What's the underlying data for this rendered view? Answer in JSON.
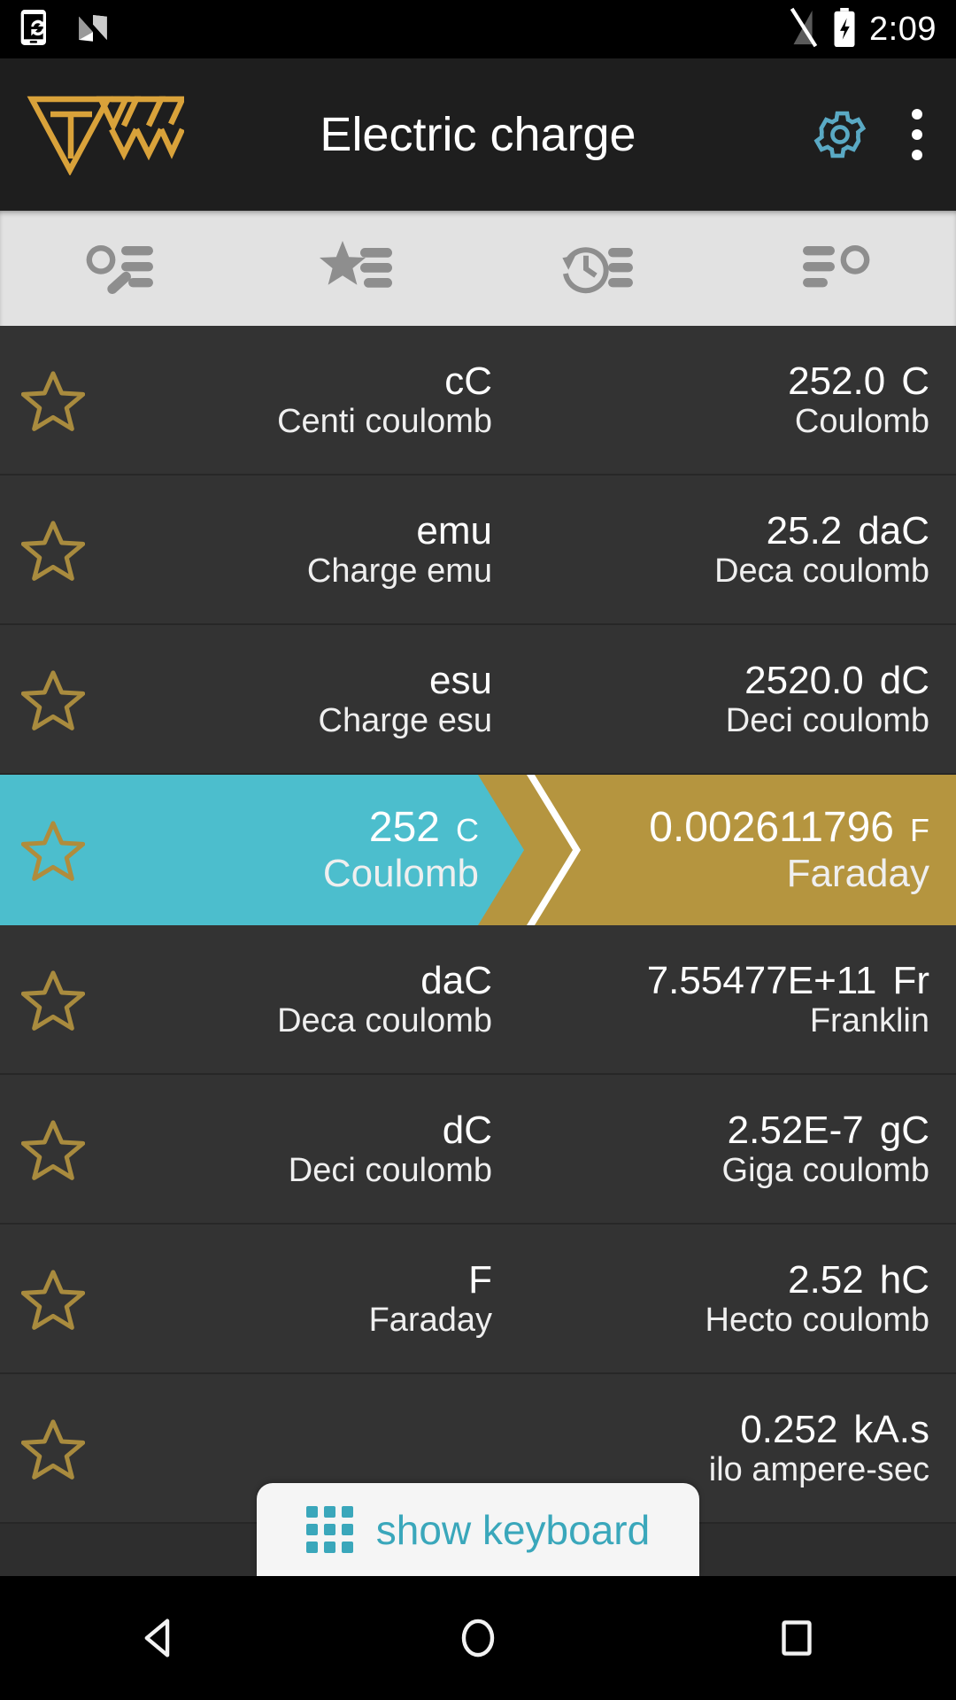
{
  "status_bar": {
    "time": "2:09",
    "icons": [
      "sync-phone-icon",
      "android-nougat-icon",
      "signal-off-icon",
      "battery-charging-icon"
    ]
  },
  "app_bar": {
    "title": "Electric charge",
    "logo_name": "tw-converter-logo",
    "settings_label": "gear-icon",
    "overflow_label": "more-options-icon",
    "accent_gold": "#d9a23a",
    "accent_teal": "#4cbecd"
  },
  "tabs": [
    {
      "name": "search",
      "icon": "search-list-icon"
    },
    {
      "name": "favorites",
      "icon": "star-list-icon"
    },
    {
      "name": "history",
      "icon": "history-clock-icon"
    },
    {
      "name": "sort",
      "icon": "list-search-icon"
    }
  ],
  "conversion": {
    "source_value": "252",
    "source_symbol": "C",
    "source_name": "Coulomb",
    "target_value": "0.002611796",
    "target_symbol": "F",
    "target_name": "Faraday",
    "source_color": "#4cbecd",
    "target_color": "#b5953f"
  },
  "rows_above": [
    {
      "symbol": "cC",
      "name": "Centi coulomb",
      "value": "252.0",
      "unit": "C",
      "unit_name": "Coulomb"
    },
    {
      "symbol": "emu",
      "name": "Charge emu",
      "value": "25.2",
      "unit": "daC",
      "unit_name": "Deca coulomb"
    },
    {
      "symbol": "esu",
      "name": "Charge esu",
      "value": "2520.0",
      "unit": "dC",
      "unit_name": "Deci coulomb"
    }
  ],
  "rows_below": [
    {
      "symbol": "daC",
      "name": "Deca coulomb",
      "value": "7.55477E+11",
      "unit": "Fr",
      "unit_name": "Franklin"
    },
    {
      "symbol": "dC",
      "name": "Deci coulomb",
      "value": "2.52E-7",
      "unit": "gC",
      "unit_name": "Giga coulomb"
    },
    {
      "symbol": "F",
      "name": "Faraday",
      "value": "2.52",
      "unit": "hC",
      "unit_name": "Hecto coulomb"
    },
    {
      "symbol": "",
      "name": "",
      "value": "0.252",
      "unit": "kA.s",
      "unit_name": "ilo ampere-sec"
    }
  ],
  "keyboard_button": {
    "label": "show keyboard",
    "icon": "keypad-grid-icon",
    "color": "#3aa7bb"
  },
  "nav_bar": {
    "back": "back-triangle-icon",
    "home": "home-circle-icon",
    "recents": "recents-square-icon"
  }
}
